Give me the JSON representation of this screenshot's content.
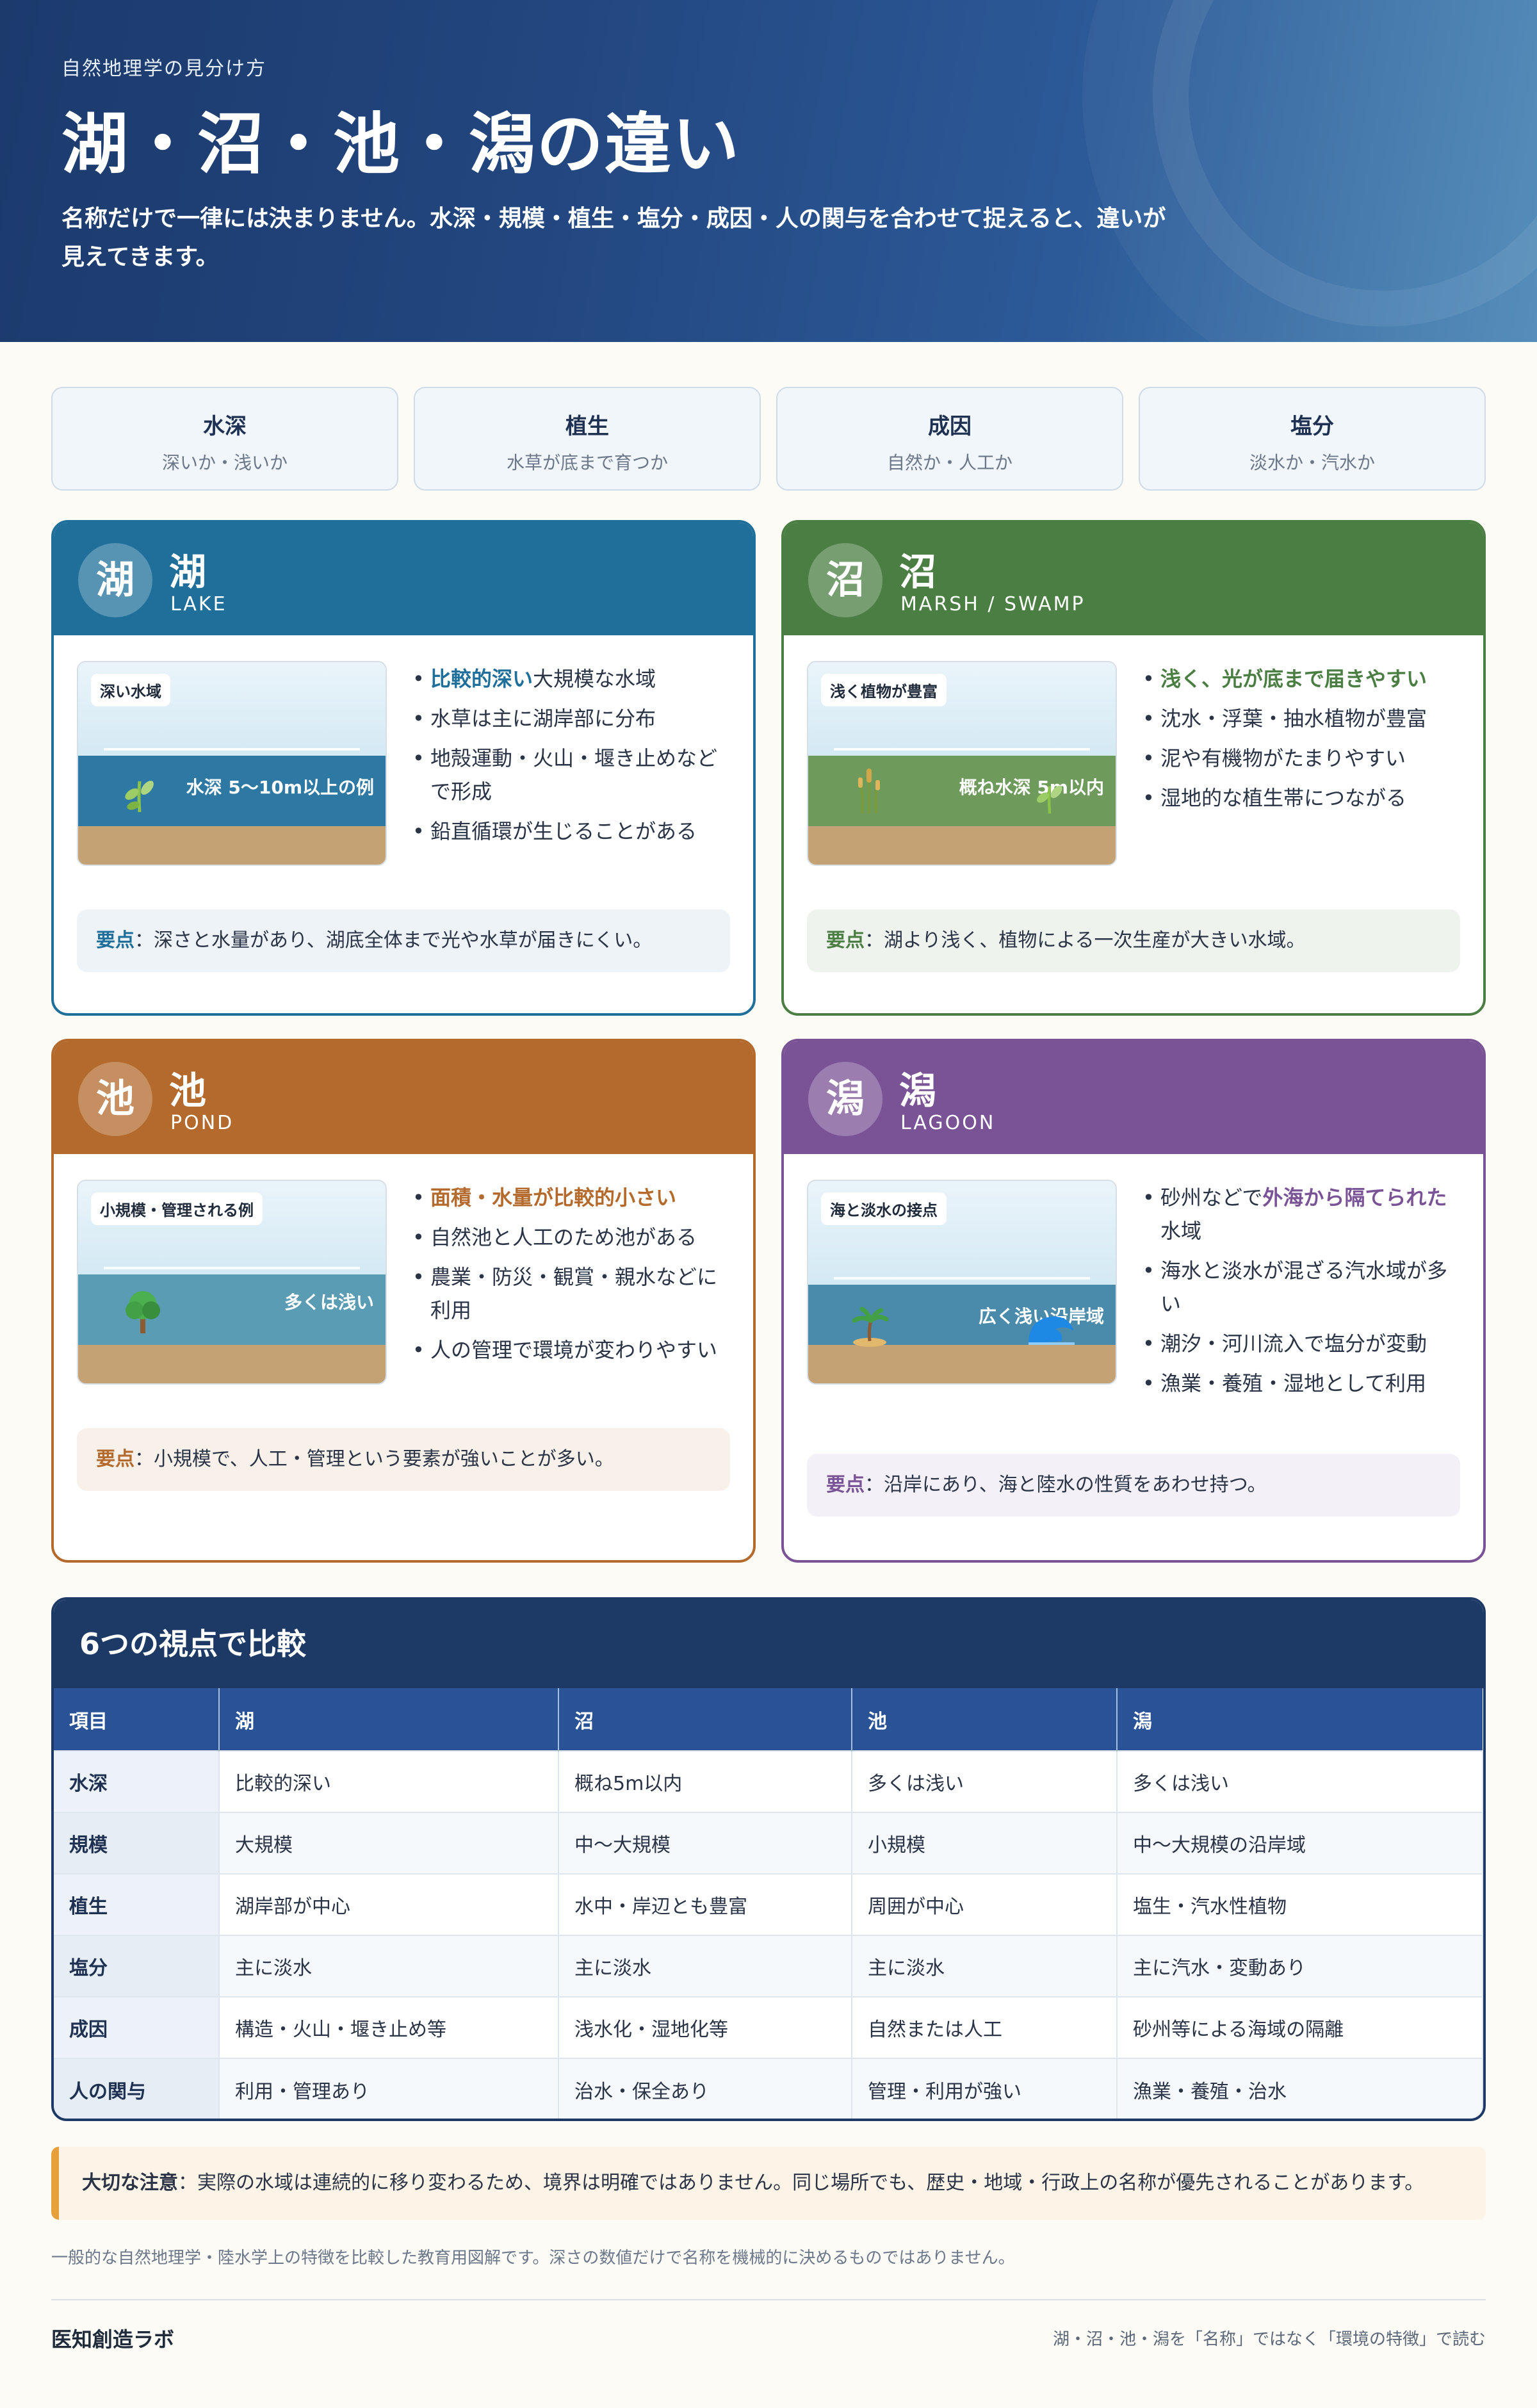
{
  "header": {
    "eyebrow": "自然地理学の見分け方",
    "title": "湖・沼・池・潟の違い",
    "lead": "名称だけで一律には決まりません。水深・規模・植生・塩分・成因・人の関与を合わせて捉えると、違いが見えてきます。"
  },
  "criteria": [
    {
      "title": "水深",
      "sub": "深いか・浅いか"
    },
    {
      "title": "植生",
      "sub": "水草が底まで育つか"
    },
    {
      "title": "成因",
      "sub": "自然か・人工か"
    },
    {
      "title": "塩分",
      "sub": "淡水か・汽水か"
    }
  ],
  "cards": {
    "lake": {
      "badge": "湖",
      "name": "湖",
      "en": "LAKE",
      "color": "#1f6f9a",
      "tag": "深い水域",
      "water_label": "水深 5〜10m以上の例",
      "icon": "sprout-icon",
      "bullet1_hl": "比較的深い",
      "bullet1_rest": "大規模な水域",
      "bullet2": "水草は主に湖岸部に分布",
      "bullet3": "地殻運動・火山・堰き止めなどで形成",
      "bullet4": "鉛直循環が生じることがある",
      "key_label": "要点",
      "key_text": "：深さと水量があり、湖底全体まで光や水草が届きにくい。"
    },
    "marsh": {
      "badge": "沼",
      "name": "沼",
      "en": "MARSH / SWAMP",
      "color": "#4a7e42",
      "tag": "浅く植物が豊富",
      "water_label": "概ね水深 5m以内",
      "icon": "reed-icon",
      "bullet1_hl": "浅く、光が底まで届きやすい",
      "bullet2": "沈水・浮葉・抽水植物が豊富",
      "bullet3": "泥や有機物がたまりやすい",
      "bullet4": "湿地的な植生帯につながる",
      "key_label": "要点",
      "key_text": "：湖より浅く、植物による一次生産が大きい水域。"
    },
    "pond": {
      "badge": "池",
      "name": "池",
      "en": "POND",
      "color": "#b36a2c",
      "tag": "小規模・管理される例",
      "water_label": "多くは浅い",
      "icon": "tree-icon",
      "bullet1_hl": "面積・水量が比較的小さい",
      "bullet2": "自然池と人工のため池がある",
      "bullet3": "農業・防災・観賞・親水などに利用",
      "bullet4": "人の管理で環境が変わりやすい",
      "key_label": "要点",
      "key_text": "：小規模で、人工・管理という要素が強いことが多い。"
    },
    "lagoon": {
      "badge": "潟",
      "name": "潟",
      "en": "LAGOON",
      "color": "#7a5296",
      "tag": "海と淡水の接点",
      "water_label": "広く浅い沿岸域",
      "icon": "island-icon",
      "bullet1_pre": "砂州などで",
      "bullet1_hl": "外海から隔てられた",
      "bullet1_post": "水域",
      "bullet2": "海水と淡水が混ざる汽水域が多い",
      "bullet3": "潮汐・河川流入で塩分が変動",
      "bullet4": "漁業・養殖・湿地として利用",
      "key_label": "要点",
      "key_text": "：沿岸にあり、海と陸水の性質をあわせ持つ。"
    }
  },
  "table": {
    "title": "6つの視点で比較",
    "headers": [
      "項目",
      "湖",
      "沼",
      "池",
      "潟"
    ],
    "rows": [
      [
        "水深",
        "比較的深い",
        "概ね5m以内",
        "多くは浅い",
        "多くは浅い"
      ],
      [
        "規模",
        "大規模",
        "中〜大規模",
        "小規模",
        "中〜大規模の沿岸域"
      ],
      [
        "植生",
        "湖岸部が中心",
        "水中・岸辺とも豊富",
        "周囲が中心",
        "塩生・汽水性植物"
      ],
      [
        "塩分",
        "主に淡水",
        "主に淡水",
        "主に淡水",
        "主に汽水・変動あり"
      ],
      [
        "成因",
        "構造・火山・堰き止め等",
        "浅水化・湿地化等",
        "自然または人工",
        "砂州等による海域の隔離"
      ],
      [
        "人の関与",
        "利用・管理あり",
        "治水・保全あり",
        "管理・利用が強い",
        "漁業・養殖・治水"
      ]
    ]
  },
  "note": {
    "label": "大切な注意",
    "text": "：実際の水域は連続的に移り変わるため、境界は明確ではありません。同じ場所でも、歴史・地域・行政上の名称が優先されることがあります。"
  },
  "footnote": "一般的な自然地理学・陸水学上の特徴を比較した教育用図解です。深さの数値だけで名称を機械的に決めるものではありません。",
  "footer": {
    "brand": "医知創造ラボ",
    "tagline": "湖・沼・池・潟を「名称」ではなく「環境の特徴」で読む"
  }
}
